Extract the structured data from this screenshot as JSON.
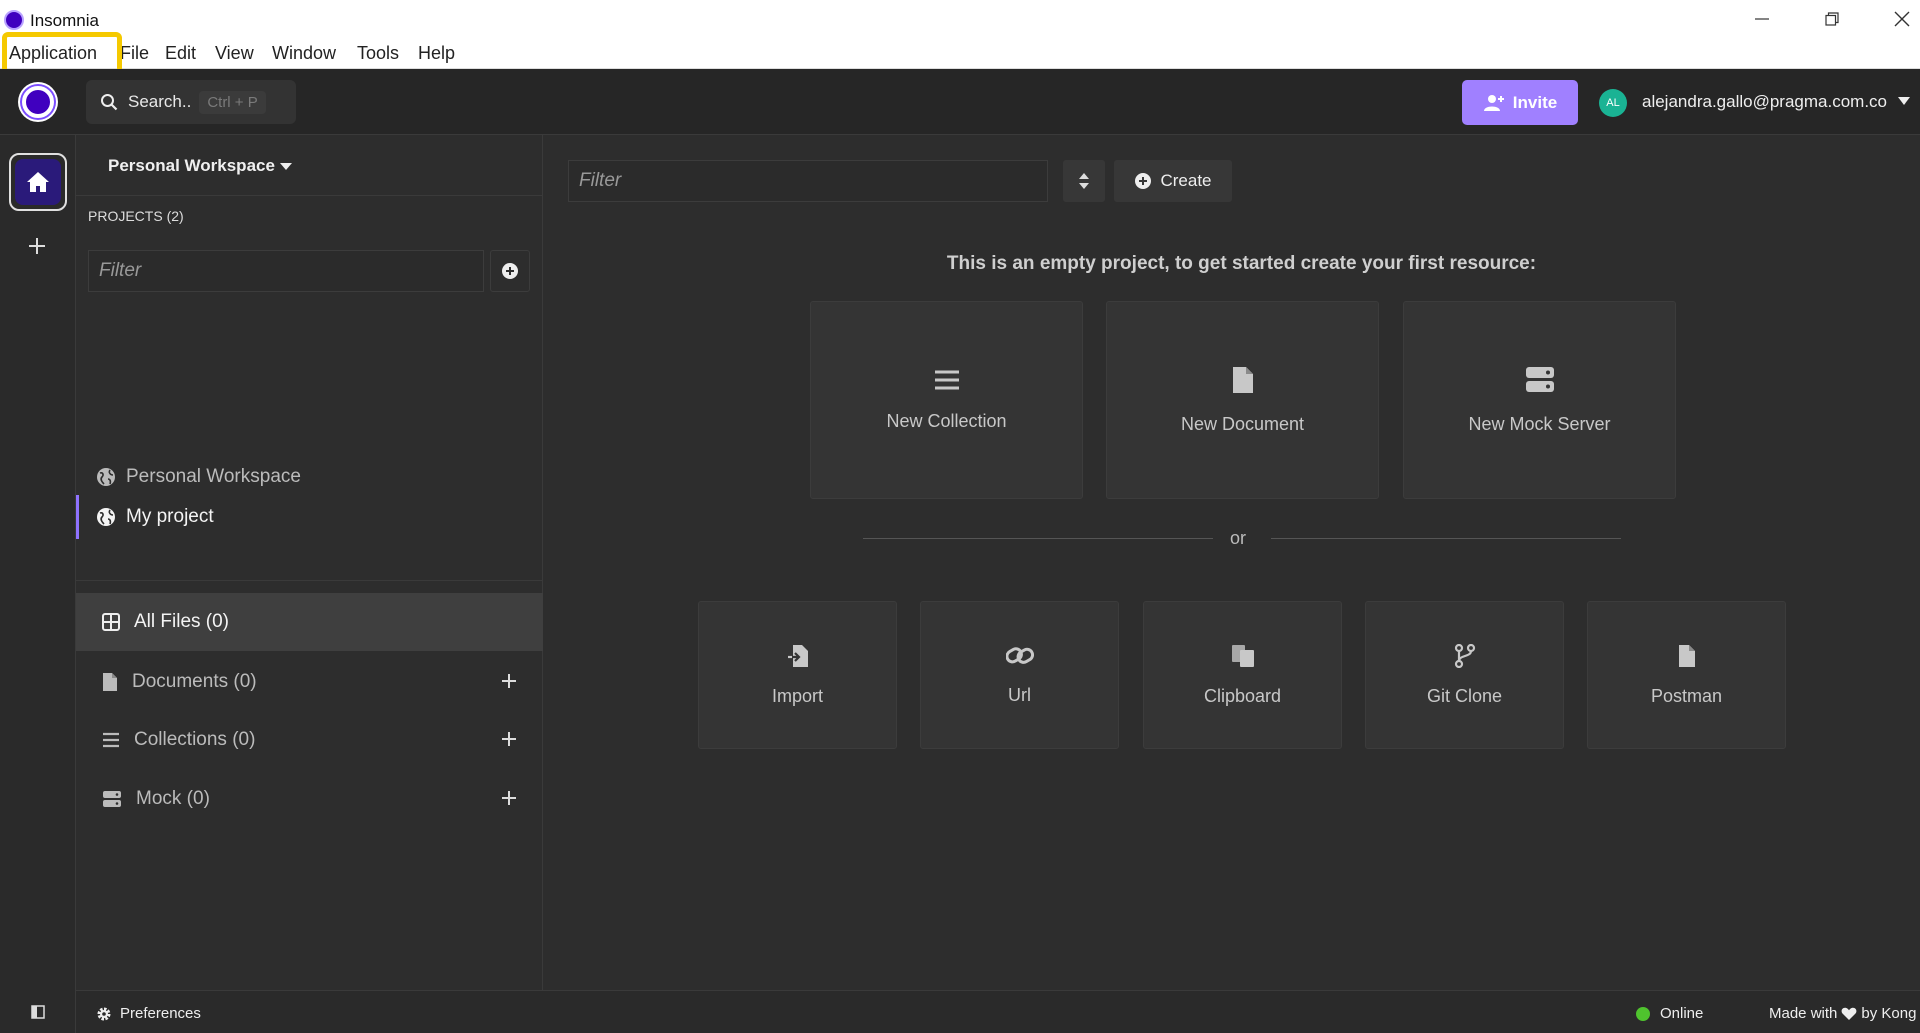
{
  "window": {
    "title": "Insomnia"
  },
  "menubar": {
    "items": [
      "Application",
      "File",
      "Edit",
      "View",
      "Window",
      "Tools",
      "Help"
    ]
  },
  "topbar": {
    "search_label": "Search..",
    "search_shortcut": "Ctrl + P",
    "invite_label": "Invite",
    "avatar_initials": "AL",
    "user_email": "alejandra.gallo@pragma.com.co"
  },
  "sidebar": {
    "workspace_title": "Personal Workspace",
    "projects_label": "PROJECTS (2)",
    "filter_placeholder": "Filter",
    "projects": [
      {
        "label": "Personal Workspace",
        "active": false
      },
      {
        "label": "My project",
        "active": true
      }
    ],
    "files": [
      {
        "label": "All Files (0)",
        "icon": "grid-icon"
      },
      {
        "label": "Documents (0)",
        "icon": "document-icon"
      },
      {
        "label": "Collections (0)",
        "icon": "list-icon"
      },
      {
        "label": "Mock (0)",
        "icon": "server-icon"
      }
    ]
  },
  "main": {
    "filter_placeholder": "Filter",
    "create_label": "Create",
    "empty_message": "This is an empty project, to get started create your first resource:",
    "resource_cards": [
      {
        "label": "New Collection",
        "icon": "list-icon"
      },
      {
        "label": "New Document",
        "icon": "document-icon"
      },
      {
        "label": "New Mock Server",
        "icon": "server-icon"
      }
    ],
    "or_label": "or",
    "import_cards": [
      {
        "label": "Import",
        "icon": "import-icon"
      },
      {
        "label": "Url",
        "icon": "link-icon"
      },
      {
        "label": "Clipboard",
        "icon": "clipboard-icon"
      },
      {
        "label": "Git Clone",
        "icon": "git-branch-icon"
      },
      {
        "label": "Postman",
        "icon": "document-icon"
      }
    ]
  },
  "statusbar": {
    "preferences_label": "Preferences",
    "online_label": "Online",
    "made_with_prefix": "Made with",
    "made_with_suffix": "by Kong"
  },
  "colors": {
    "accent": "#a080ff",
    "brand": "#4000bf",
    "online": "#4fc32e",
    "highlight": "#f5c900"
  }
}
